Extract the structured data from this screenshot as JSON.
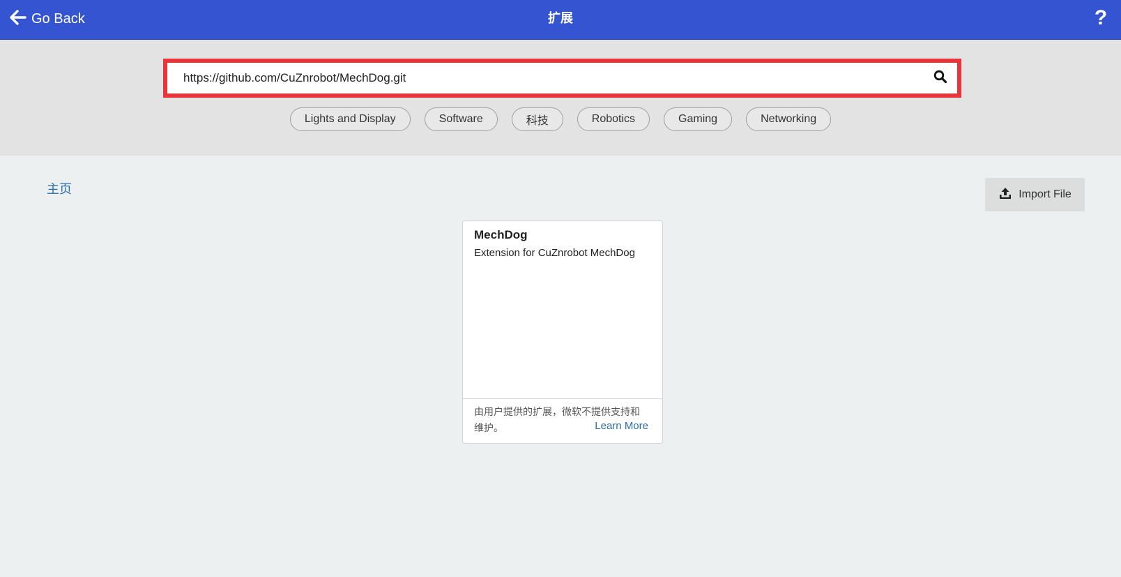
{
  "header": {
    "back_label": "Go Back",
    "title": "扩展",
    "help_label": "?"
  },
  "search": {
    "value": "https://github.com/CuZnrobot/MechDog.git",
    "placeholder": ""
  },
  "categories": [
    "Lights and Display",
    "Software",
    "科技",
    "Robotics",
    "Gaming",
    "Networking"
  ],
  "breadcrumb": {
    "home": "主页"
  },
  "import": {
    "label": "Import File"
  },
  "extension_card": {
    "name": "MechDog",
    "description": "Extension for CuZnrobot MechDog",
    "note": "由用户提供的扩展，微软不提供支持和维护。",
    "learn_more": "Learn More"
  },
  "colors": {
    "header_bg": "#3454d1",
    "highlight_border": "#e8353b",
    "link": "#2c6ea8"
  }
}
